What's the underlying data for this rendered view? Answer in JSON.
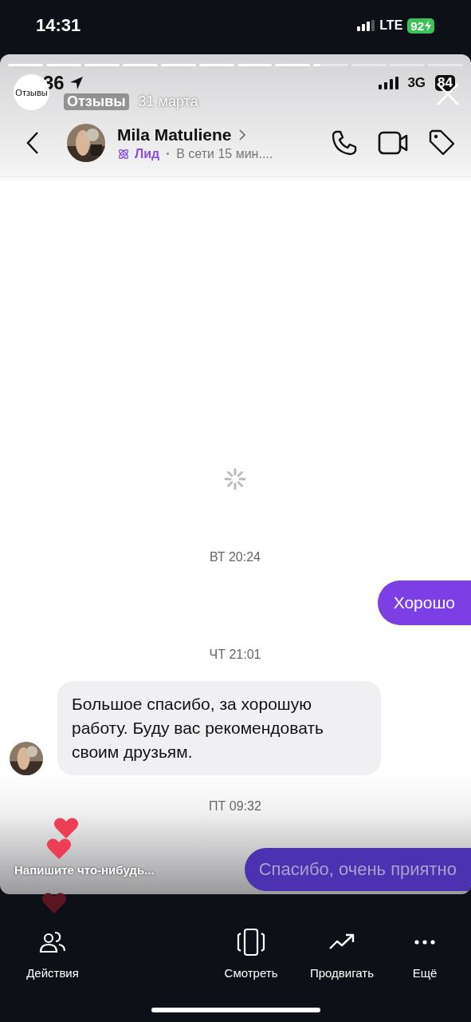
{
  "status_bar": {
    "time": "14:31",
    "network": "LTE",
    "battery": "92"
  },
  "story": {
    "progress": [
      {
        "kind": "seen"
      },
      {
        "kind": "seen"
      },
      {
        "kind": "seen"
      },
      {
        "kind": "seen"
      },
      {
        "kind": "seen"
      },
      {
        "kind": "seen"
      },
      {
        "kind": "seen"
      },
      {
        "kind": "seen"
      },
      {
        "kind": "current",
        "level": 0.2
      },
      {
        "kind": "unseen"
      },
      {
        "kind": "unseen"
      },
      {
        "kind": "unseen"
      }
    ],
    "avatar_text": "Отзывы",
    "account": "Отзывы",
    "date": "31 марта",
    "reply_placeholder": "Напишите что-нибудь...",
    "sent_reply": "Спасибо, очень приятно"
  },
  "screenshot": {
    "status_bar": {
      "time": "36",
      "network": "3G",
      "battery": "84"
    },
    "contact": {
      "name": "Mila Matuliene",
      "tag": "Лид",
      "presence": "В сети 15 мин...."
    },
    "messages": [
      {
        "kind": "time",
        "text": "ВТ 20:24"
      },
      {
        "kind": "outgoing",
        "text": "Хорошо"
      },
      {
        "kind": "time",
        "text": "ЧТ 21:01"
      },
      {
        "kind": "incoming",
        "text": "Большое спасибо, за хорошую работу. Буду вас рекомендовать своим друзьям."
      },
      {
        "kind": "time",
        "text": "ПТ 09:32"
      }
    ]
  },
  "bottom_bar": [
    {
      "kind": "people",
      "label": "Действия"
    },
    {
      "kind": "phone",
      "label": "Смотреть"
    },
    {
      "kind": "trend",
      "label": "Продвигать"
    },
    {
      "kind": "more",
      "label": "Ещё"
    }
  ]
}
